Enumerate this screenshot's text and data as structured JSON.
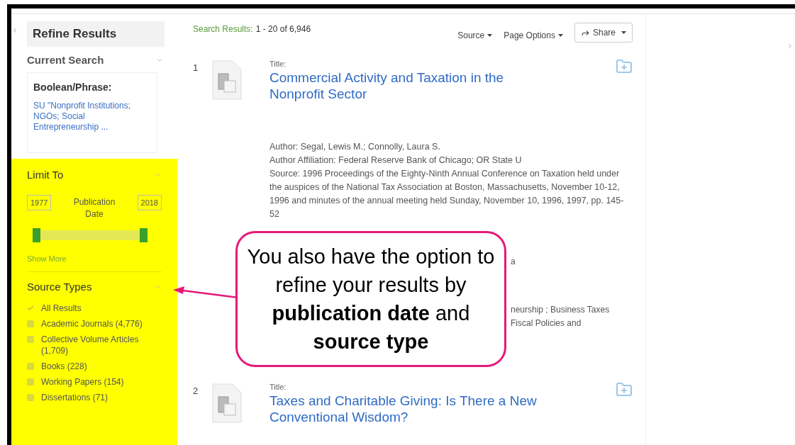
{
  "sidebar": {
    "title": "Refine Results",
    "current_search": {
      "heading": "Current Search",
      "expanded": true,
      "label": "Boolean/Phrase:",
      "query": "SU \"Nonprofit Institutions; NGOs; Social Entrepreneurship ..."
    },
    "limit_to": {
      "heading": "Limit To",
      "highlighted": true,
      "from": "1977",
      "to": "2018",
      "label": "Publication Date",
      "thumbs": [
        {
          "level": 0
        },
        {
          "level": 1
        }
      ],
      "show_more": "Show More"
    },
    "source_types": {
      "heading": "Source Types",
      "items": [
        {
          "label": "All Results",
          "checked": true
        },
        {
          "label": "Academic Journals (4,776)",
          "checked": false
        },
        {
          "label": "Collective Volume Articles (1,709)",
          "checked": false
        },
        {
          "label": "Books (228)",
          "checked": false
        },
        {
          "label": "Working Papers (154)",
          "checked": false
        },
        {
          "label": "Dissertations (71)",
          "checked": false
        }
      ]
    }
  },
  "toolbar": {
    "label": "Search Results:",
    "count": "1 - 20 of 6,946",
    "menus": [
      "Source",
      "Page Options"
    ],
    "share": "Share"
  },
  "results": [
    {
      "number": "1",
      "title_label": "Title:",
      "title": "Commercial Activity and Taxation in the Nonprofit Sector",
      "details": [
        "Author: Segal, Lewis M.; Connolly, Laura S.",
        "Author Affiliation: Federal Reserve Bank of Chicago; OR State U",
        "Source: 1996 Proceedings of the Eighty-Ninth Annual Conference on Taxation held under the auspices of the National Tax Association at Boston, Massachusetts, November 10-12, 1996 and minutes of the annual meeting held Sunday, November 10, 1996, 1997, pp. 145-52"
      ],
      "partly_hidden": [
        "a",
        "neurship ; Business Taxes",
        "Fiscal Policies and"
      ]
    },
    {
      "number": "2",
      "title_label": "Title:",
      "title": "Taxes and Charitable Giving: Is There a New Conventional Wisdom?"
    }
  ],
  "callout": {
    "text": "You also have the option to refine your results by **publication date** and **source type**"
  }
}
